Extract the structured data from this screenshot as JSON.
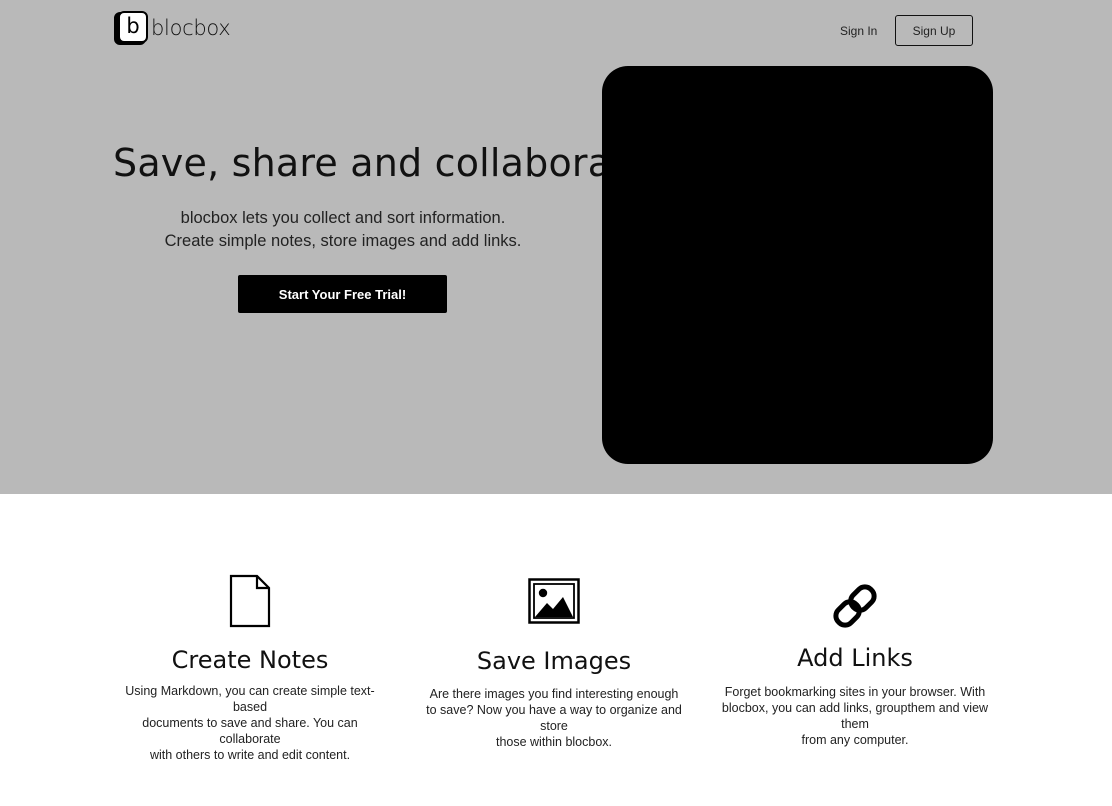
{
  "brand": {
    "logo_letter": "b",
    "name": "blocbox"
  },
  "nav": {
    "sign_in": "Sign In",
    "sign_up": "Sign Up"
  },
  "hero": {
    "title": "Save, share and collaborate",
    "subtitle_line1": "blocbox lets you collect and sort information.",
    "subtitle_line2": "Create simple notes, store images and add links.",
    "cta": "Start Your Free Trial!"
  },
  "features": [
    {
      "icon": "document-icon",
      "title": "Create Notes",
      "desc_line1": "Using Markdown, you can create simple text-based",
      "desc_line2": "documents to save and share. You can collaborate",
      "desc_line3": "with others to write and edit content."
    },
    {
      "icon": "image-icon",
      "title": "Save Images",
      "desc_line1": "Are there images you find interesting enough",
      "desc_line2": "to save? Now you have a way to organize and store",
      "desc_line3": "those within blocbox."
    },
    {
      "icon": "link-icon",
      "title": "Add Links",
      "desc_line1": "Forget bookmarking sites in your browser. With",
      "desc_line2": "blocbox, you can add links, groupthem and view them",
      "desc_line3": "from any computer."
    }
  ],
  "colors": {
    "hero_bg": "#b9b9b9",
    "cta_bg": "#000000",
    "media_bg": "#000000",
    "page_bg": "#ffffff"
  }
}
